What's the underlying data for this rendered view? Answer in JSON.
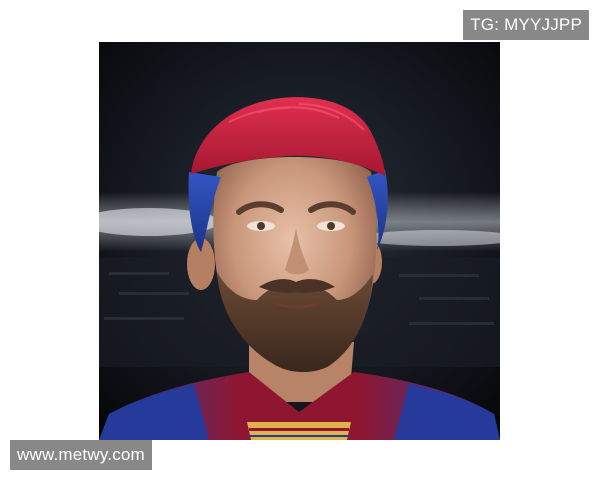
{
  "watermarks": {
    "top_right": "TG: MYYJJPP",
    "bottom_left": "www.metwy.com"
  },
  "photo": {
    "subject_icon": "portrait-photo",
    "colors": {
      "hair_top": "#c0203a",
      "hair_side": "#2648a8",
      "background": "#12151c",
      "stadium_light": "#e6ecf4",
      "jersey_blue": "#253a9a",
      "jersey_red": "#8e1630",
      "collar_gold": "#e0b24a"
    }
  }
}
